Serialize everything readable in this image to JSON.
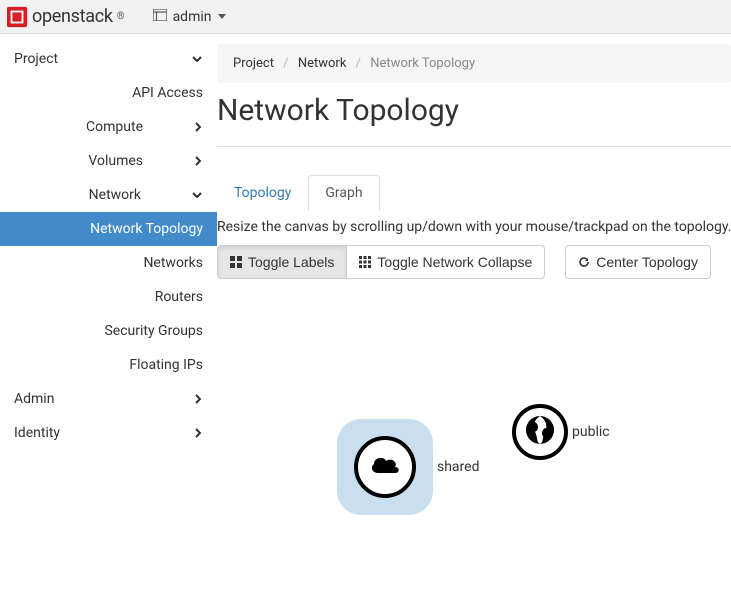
{
  "brand": "openstack",
  "user": {
    "name": "admin"
  },
  "sidebar": {
    "project": "Project",
    "api_access": "API Access",
    "compute": "Compute",
    "volumes": "Volumes",
    "network": "Network",
    "network_topology": "Network Topology",
    "networks": "Networks",
    "routers": "Routers",
    "security_groups": "Security Groups",
    "floating_ips": "Floating IPs",
    "admin": "Admin",
    "identity": "Identity"
  },
  "breadcrumb": {
    "a": "Project",
    "b": "Network",
    "c": "Network Topology"
  },
  "page_title": "Network Topology",
  "tabs": {
    "topology": "Topology",
    "graph": "Graph"
  },
  "help": "Resize the canvas by scrolling up/down with your mouse/trackpad on the topology. Pan",
  "buttons": {
    "toggle_labels": "Toggle Labels",
    "toggle_collapse": "Toggle Network Collapse",
    "center": "Center Topology"
  },
  "nodes": {
    "shared": "shared",
    "public": "public"
  }
}
